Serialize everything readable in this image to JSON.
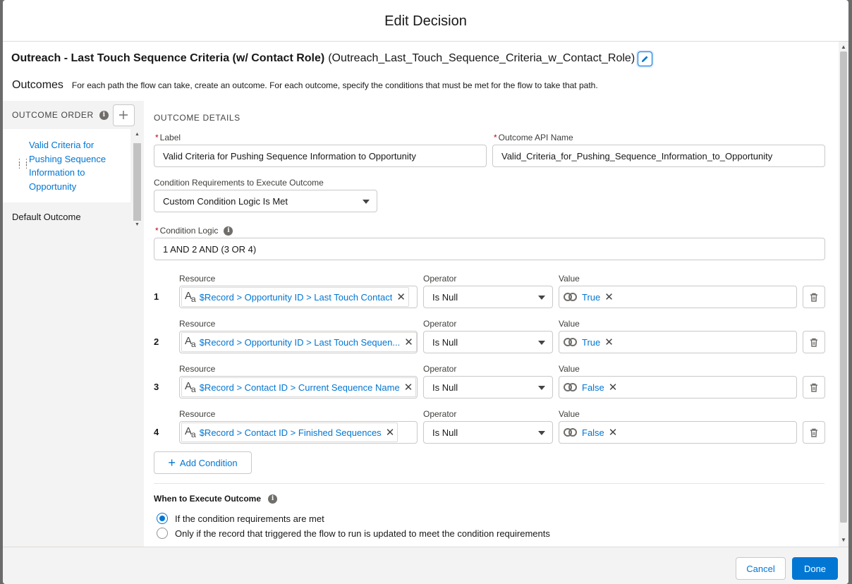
{
  "modal": {
    "title": "Edit Decision"
  },
  "element": {
    "label": "Outreach - Last Touch Sequence Criteria (w/ Contact Role)",
    "api_name": "(Outreach_Last_Touch_Sequence_Criteria_w_Contact_Role)",
    "edit_icon": "pencil-icon"
  },
  "outcomes": {
    "title": "Outcomes",
    "help": "For each path the flow can take, create an outcome. For each outcome, specify the conditions that must be met for the flow to take that path."
  },
  "outcome_order": {
    "title": "OUTCOME ORDER",
    "items": [
      {
        "label": "Valid Criteria for Pushing Sequence Information to Opportunity",
        "active": true
      },
      {
        "label": "Default Outcome",
        "active": false
      }
    ]
  },
  "details": {
    "heading": "OUTCOME DETAILS",
    "label_field": {
      "label": "Label",
      "value": "Valid Criteria for Pushing Sequence Information to Opportunity"
    },
    "api_field": {
      "label": "Outcome API Name",
      "value": "Valid_Criteria_for_Pushing_Sequence_Information_to_Opportunity"
    },
    "requirements": {
      "label": "Condition Requirements to Execute Outcome",
      "value": "Custom Condition Logic Is Met"
    },
    "logic": {
      "label": "Condition Logic",
      "value": "1 AND 2 AND (3 OR 4)"
    },
    "column_labels": {
      "resource": "Resource",
      "operator": "Operator",
      "value": "Value"
    },
    "conditions": [
      {
        "num": "1",
        "resource": "$Record > Opportunity ID > Last Touch Contact",
        "operator": "Is Null",
        "value": "True"
      },
      {
        "num": "2",
        "resource": "$Record > Opportunity ID > Last Touch Sequen...",
        "operator": "Is Null",
        "value": "True"
      },
      {
        "num": "3",
        "resource": "$Record > Contact ID > Current Sequence Name",
        "operator": "Is Null",
        "value": "False"
      },
      {
        "num": "4",
        "resource": "$Record > Contact ID > Finished Sequences",
        "operator": "Is Null",
        "value": "False"
      }
    ],
    "add_condition": "Add Condition",
    "when": {
      "title": "When to Execute Outcome",
      "options": [
        {
          "label": "If the condition requirements are met",
          "selected": true
        },
        {
          "label": "Only if the record that triggered the flow to run is updated to meet the condition requirements",
          "selected": false
        }
      ]
    }
  },
  "footer": {
    "cancel": "Cancel",
    "done": "Done"
  },
  "colors": {
    "brand": "#0176d3",
    "required": "#ba0517"
  }
}
